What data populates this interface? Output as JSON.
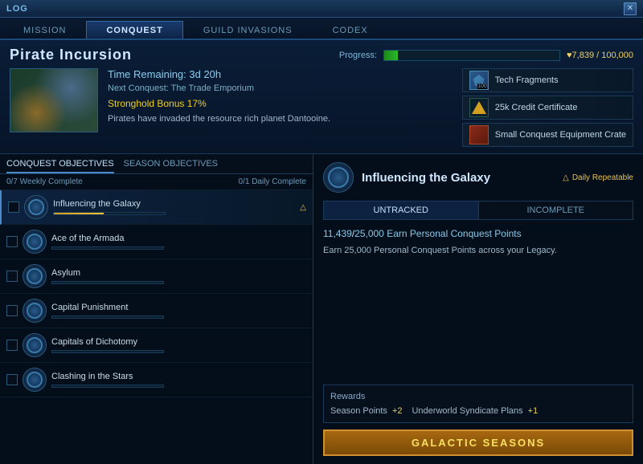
{
  "titlebar": {
    "label": "LOG",
    "close": "✕"
  },
  "tabs": [
    {
      "id": "mission",
      "label": "MISSION",
      "active": false
    },
    {
      "id": "conquest",
      "label": "CONQUEST",
      "active": true
    },
    {
      "id": "guild",
      "label": "GUILD INVASIONS",
      "active": false
    },
    {
      "id": "codex",
      "label": "CODEX",
      "active": false
    }
  ],
  "header": {
    "event_title": "Pirate Incursion",
    "progress_label": "Progress:",
    "progress_percent": 7.839,
    "progress_current": "7,839",
    "progress_max": "100,000",
    "progress_text": "♥7,839 / 100,000",
    "time_remaining": "Time Remaining: 3d 20h",
    "next_conquest": "Next Conquest: The Trade Emporium",
    "stronghold_bonus": "Stronghold Bonus 17%",
    "description": "Pirates have invaded the resource rich planet Dantooine.",
    "rewards": [
      {
        "id": "tech-fragments",
        "label": "Tech Fragments",
        "has_count": true,
        "count": "100"
      },
      {
        "id": "credit-cert",
        "label": "25k Credit Certificate"
      },
      {
        "id": "equip-crate",
        "label": "Small Conquest Equipment Crate"
      }
    ]
  },
  "objectives": {
    "tab1": "CONQUEST OBJECTIVES",
    "tab2": "SEASON OBJECTIVES",
    "weekly": "0/7 Weekly Complete",
    "daily": "0/1 Daily Complete",
    "items": [
      {
        "id": "influencing",
        "name": "Influencing the Galaxy",
        "progress": 45,
        "selected": true,
        "daily": true
      },
      {
        "id": "ace",
        "name": "Ace of the Armada",
        "progress": 0,
        "selected": false,
        "daily": false
      },
      {
        "id": "asylum",
        "name": "Asylum",
        "progress": 0,
        "selected": false,
        "daily": false
      },
      {
        "id": "capital-pun",
        "name": "Capital Punishment",
        "progress": 0,
        "selected": false,
        "daily": false
      },
      {
        "id": "capitals-dic",
        "name": "Capitals of Dichotomy",
        "progress": 0,
        "selected": false,
        "daily": false
      },
      {
        "id": "clashing",
        "name": "Clashing in the Stars",
        "progress": 0,
        "selected": false,
        "daily": false
      }
    ]
  },
  "detail": {
    "title": "Influencing the Galaxy",
    "daily_repeatable": "Daily Repeatable",
    "track_tabs": [
      "UNTRACKED",
      "INCOMPLETE"
    ],
    "active_track": "UNTRACKED",
    "score_current": "11,439",
    "score_max": "25,000",
    "score_label": "Earn Personal Conquest Points",
    "description": "Earn 25,000 Personal Conquest Points across your Legacy.",
    "rewards_title": "Rewards",
    "season_points_label": "Season Points",
    "season_points_value": "+2",
    "underworld_label": "Underworld Syndicate Plans",
    "underworld_value": "+1",
    "galactic_btn": "GALACTIC SEASONS"
  }
}
